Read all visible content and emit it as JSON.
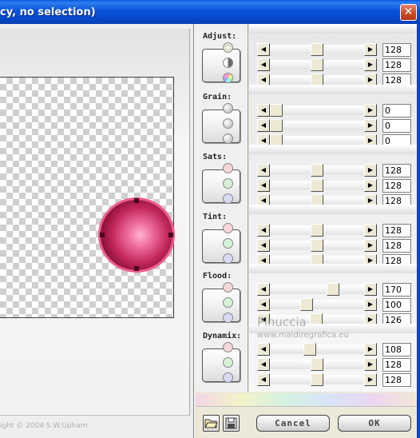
{
  "window": {
    "title": "cy, no selection)",
    "close_glyph": "✕"
  },
  "preview": {
    "copyright": "ight  © 2004  S.W.Upham"
  },
  "groups": [
    {
      "label": "Adjust:",
      "icons": [
        "sun-icon",
        "contrast-icon",
        "color-wheel-icon"
      ],
      "sliders": [
        {
          "value": "128",
          "fraction": 0.5
        },
        {
          "value": "128",
          "fraction": 0.5
        },
        {
          "value": "128",
          "fraction": 0.5
        }
      ]
    },
    {
      "label": "Grain:",
      "icons": [
        "grain-icon",
        "grain-icon",
        "grain-icon"
      ],
      "sliders": [
        {
          "value": "0",
          "fraction": 0.0
        },
        {
          "value": "0",
          "fraction": 0.0
        },
        {
          "value": "0",
          "fraction": 0.0
        }
      ]
    },
    {
      "label": "Sats:",
      "icons": [
        "red-dot-icon",
        "green-dot-icon",
        "blue-dot-icon"
      ],
      "sliders": [
        {
          "value": "128",
          "fraction": 0.5
        },
        {
          "value": "128",
          "fraction": 0.5
        },
        {
          "value": "128",
          "fraction": 0.5
        }
      ]
    },
    {
      "label": "Tint:",
      "icons": [
        "red-dot-icon",
        "green-dot-icon",
        "blue-dot-icon"
      ],
      "sliders": [
        {
          "value": "128",
          "fraction": 0.5
        },
        {
          "value": "128",
          "fraction": 0.5
        },
        {
          "value": "128",
          "fraction": 0.5
        }
      ]
    },
    {
      "label": "Flood:",
      "icons": [
        "red-dot-icon",
        "green-dot-icon",
        "blue-dot-icon"
      ],
      "sliders": [
        {
          "value": "170",
          "fraction": 0.667
        },
        {
          "value": "100",
          "fraction": 0.392
        },
        {
          "value": "126",
          "fraction": 0.494
        }
      ]
    },
    {
      "label": "Dynamix:",
      "icons": [
        "red-dot-icon",
        "green-dot-icon",
        "blue-dot-icon"
      ],
      "sliders": [
        {
          "value": "108",
          "fraction": 0.424
        },
        {
          "value": "128",
          "fraction": 0.5
        },
        {
          "value": "128",
          "fraction": 0.5
        }
      ]
    }
  ],
  "arrows": {
    "left": "◀",
    "right": "▶"
  },
  "buttons": {
    "cancel": "Cancel",
    "ok": "OK",
    "open_icon": "folder-open-icon",
    "save_icon": "floppy-disk-icon"
  },
  "watermark": {
    "line1": "Pinuccia",
    "line2": "www.maidiregrafica.eu"
  },
  "colors": {
    "title_bar": "#0853d8",
    "sphere": "#c3285d",
    "red_dot": "#f7d6da",
    "green_dot": "#d6f2d6",
    "blue_dot": "#d8daf4"
  }
}
